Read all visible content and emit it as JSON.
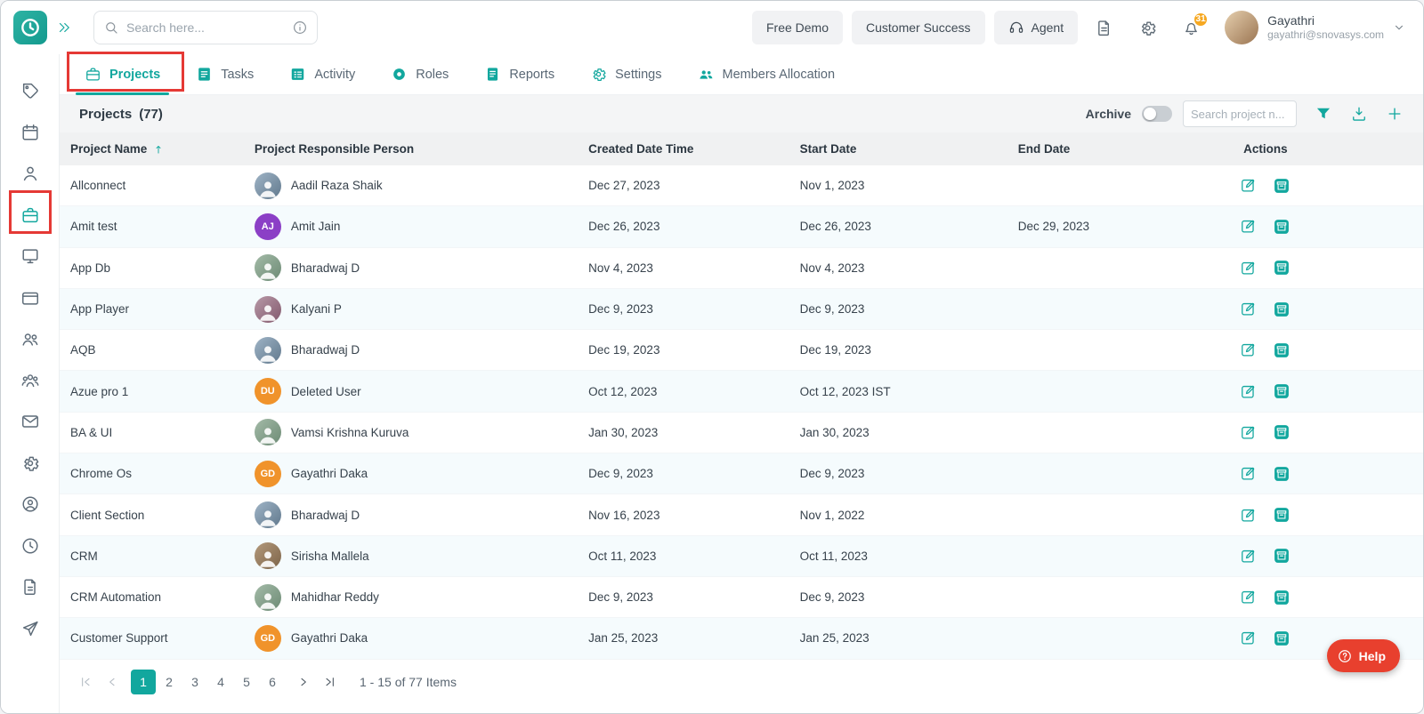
{
  "header": {
    "search_placeholder": "Search here...",
    "free_demo": "Free Demo",
    "customer_success": "Customer Success",
    "agent": "Agent",
    "notification_count": "31",
    "user_name": "Gayathri",
    "user_email": "gayathri@snovasys.com"
  },
  "tabs": [
    {
      "label": "Projects",
      "icon": "briefcase",
      "active": true
    },
    {
      "label": "Tasks",
      "icon": "tasks",
      "active": false
    },
    {
      "label": "Activity",
      "icon": "activity",
      "active": false
    },
    {
      "label": "Roles",
      "icon": "roles",
      "active": false
    },
    {
      "label": "Reports",
      "icon": "reports",
      "active": false
    },
    {
      "label": "Settings",
      "icon": "gear",
      "active": false
    },
    {
      "label": "Members Allocation",
      "icon": "members",
      "active": false
    }
  ],
  "sidebar_items": [
    {
      "name": "tags",
      "icon": "tag",
      "active": false
    },
    {
      "name": "planner",
      "icon": "planner",
      "active": false
    },
    {
      "name": "user",
      "icon": "user",
      "active": false
    },
    {
      "name": "projects",
      "icon": "briefcase",
      "active": true
    },
    {
      "name": "monitor",
      "icon": "monitor",
      "active": false
    },
    {
      "name": "billing",
      "icon": "wallet",
      "active": false
    },
    {
      "name": "users",
      "icon": "users",
      "active": false
    },
    {
      "name": "team",
      "icon": "team",
      "active": false
    },
    {
      "name": "mail",
      "icon": "mail",
      "active": false
    },
    {
      "name": "settings",
      "icon": "gear",
      "active": false
    },
    {
      "name": "profile",
      "icon": "profile",
      "active": false
    },
    {
      "name": "time",
      "icon": "time",
      "active": false
    },
    {
      "name": "documents",
      "icon": "doc",
      "active": false
    },
    {
      "name": "send",
      "icon": "send",
      "active": false
    }
  ],
  "toolbar": {
    "title": "Projects",
    "count": "(77)",
    "archive_label": "Archive",
    "archive_on": false,
    "search_placeholder": "Search project n..."
  },
  "table": {
    "columns": [
      "Project Name",
      "Project Responsible Person",
      "Created Date Time",
      "Start Date",
      "End Date",
      "Actions"
    ],
    "rows": [
      {
        "name": "Allconnect",
        "person": "Aadil Raza Shaik",
        "avatar": {
          "type": "photo"
        },
        "created": "Dec 27, 2023",
        "start": "Nov 1, 2023",
        "end": ""
      },
      {
        "name": "Amit test",
        "person": "Amit Jain",
        "avatar": {
          "type": "initials",
          "text": "AJ",
          "color": "#8b3fc6"
        },
        "created": "Dec 26, 2023",
        "start": "Dec 26, 2023",
        "end": "Dec 29, 2023"
      },
      {
        "name": "App Db",
        "person": "Bharadwaj D",
        "avatar": {
          "type": "photo"
        },
        "created": "Nov 4, 2023",
        "start": "Nov 4, 2023",
        "end": ""
      },
      {
        "name": "App Player",
        "person": "Kalyani P",
        "avatar": {
          "type": "photo"
        },
        "created": "Dec 9, 2023",
        "start": "Dec 9, 2023",
        "end": ""
      },
      {
        "name": "AQB",
        "person": "Bharadwaj D",
        "avatar": {
          "type": "photo"
        },
        "created": "Dec 19, 2023",
        "start": "Dec 19, 2023",
        "end": ""
      },
      {
        "name": "Azue pro 1",
        "person": "Deleted User",
        "avatar": {
          "type": "initials",
          "text": "DU",
          "color": "#f0932b"
        },
        "created": "Oct 12, 2023",
        "start": "Oct 12, 2023 IST",
        "end": ""
      },
      {
        "name": "BA & UI",
        "person": "Vamsi Krishna Kuruva",
        "avatar": {
          "type": "photo"
        },
        "created": "Jan 30, 2023",
        "start": "Jan 30, 2023",
        "end": ""
      },
      {
        "name": "Chrome Os",
        "person": "Gayathri Daka",
        "avatar": {
          "type": "initials",
          "text": "GD",
          "color": "#f0932b"
        },
        "created": "Dec 9, 2023",
        "start": "Dec 9, 2023",
        "end": ""
      },
      {
        "name": "Client Section",
        "person": "Bharadwaj D",
        "avatar": {
          "type": "photo"
        },
        "created": "Nov 16, 2023",
        "start": "Nov 1, 2022",
        "end": ""
      },
      {
        "name": "CRM",
        "person": "Sirisha Mallela",
        "avatar": {
          "type": "photo"
        },
        "created": "Oct 11, 2023",
        "start": "Oct 11, 2023",
        "end": ""
      },
      {
        "name": "CRM Automation",
        "person": "Mahidhar Reddy",
        "avatar": {
          "type": "photo"
        },
        "created": "Dec 9, 2023",
        "start": "Dec 9, 2023",
        "end": ""
      },
      {
        "name": "Customer Support",
        "person": "Gayathri Daka",
        "avatar": {
          "type": "initials",
          "text": "GD",
          "color": "#f0932b"
        },
        "created": "Jan 25, 2023",
        "start": "Jan 25, 2023",
        "end": ""
      }
    ]
  },
  "pagination": {
    "pages": [
      "1",
      "2",
      "3",
      "4",
      "5",
      "6"
    ],
    "active_page": "1",
    "summary": "1 - 15 of 77 Items"
  },
  "help_label": "Help",
  "colors": {
    "primary": "#12a79e",
    "annotation": "#e53935",
    "help_button": "#e8402e",
    "badge": "#f6a821",
    "row_alt": "#f5fbfd"
  }
}
